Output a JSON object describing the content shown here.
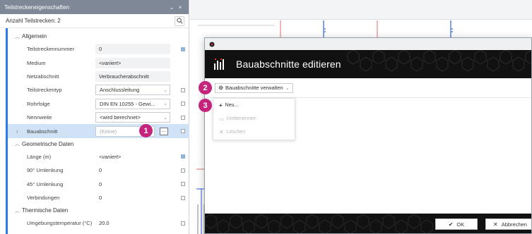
{
  "panel": {
    "title": "Teilstreckeneigenschaften",
    "title_controls": [
      "⌄",
      "×"
    ],
    "count_label": "Anzahl Teilstrecken: 2",
    "sections": {
      "allgemein": "Allgemein",
      "geometrisch": "Geometrische Daten",
      "thermisch": "Thermische Daten"
    },
    "rows": [
      {
        "key": "Teilstreckennummer",
        "value": "0"
      },
      {
        "key": "Medium",
        "value": "<variiert>"
      },
      {
        "key": "Netzabschnitt",
        "value": "Verbraucherabschnitt"
      },
      {
        "key": "Teilstreckentyp",
        "value": "Anschlussleitung"
      },
      {
        "key": "Rohrfolge",
        "value": "DIN EN 10255 - Gewi..."
      },
      {
        "key": "Nennweite",
        "value": "<wird berechnet>"
      },
      {
        "key": "Bauabschnitt",
        "value": "(Keine)"
      },
      {
        "key": "Länge (m)",
        "value": "<variiert>"
      },
      {
        "key": "90° Umlenkung",
        "value": "0"
      },
      {
        "key": "45° Umlenkung",
        "value": "0"
      },
      {
        "key": "Verbindungen",
        "value": "0"
      },
      {
        "key": "Umgebungstemperatur (°C)",
        "value": "20.0"
      }
    ],
    "ellipsis": "..."
  },
  "dialog": {
    "title": "Bauabschnitte editieren",
    "manage_button": "Bauabschnitte verwalten",
    "menu": {
      "new": "Neu...",
      "rename": "Umbenennen",
      "delete": "Löschen"
    },
    "ok": "OK",
    "cancel": "Abbrechen"
  },
  "badges": [
    "1",
    "2",
    "3"
  ],
  "colors": {
    "accent_blue": "#2b7ce4",
    "badge_magenta": "#c4247c",
    "panel_titlebar": "#7f8896",
    "selected_row": "#cfe2f6",
    "banner_black": "#111111"
  }
}
